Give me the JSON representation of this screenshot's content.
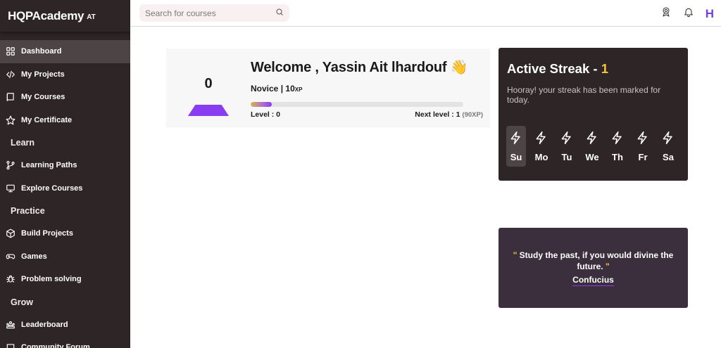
{
  "brand": {
    "name": "HQPAcademy",
    "suffix": "AT"
  },
  "sidebar": {
    "items": [
      {
        "label": "Dashboard",
        "icon": "grid-icon",
        "active": true
      },
      {
        "label": "My Projects",
        "icon": "code-icon"
      },
      {
        "label": "My Courses",
        "icon": "book-icon"
      },
      {
        "label": "My Certificate",
        "icon": "star-icon"
      },
      {
        "section": "Learn"
      },
      {
        "label": "Learning Paths",
        "icon": "path-icon"
      },
      {
        "label": "Explore Courses",
        "icon": "monitor-icon"
      },
      {
        "section": "Practice"
      },
      {
        "label": "Build Projects",
        "icon": "cube-icon"
      },
      {
        "label": "Games",
        "icon": "gamepad-icon"
      },
      {
        "label": "Problem solving",
        "icon": "bug-icon"
      },
      {
        "section": "Grow"
      },
      {
        "label": "Leaderboard",
        "icon": "users-icon"
      },
      {
        "label": "Community Forum",
        "icon": "forum-icon"
      }
    ]
  },
  "header": {
    "search_placeholder": "Search for courses",
    "avatar_letter": "H",
    "icons": [
      "award-icon",
      "bell-icon"
    ]
  },
  "welcome": {
    "level_number": "0",
    "title": "Welcome , Yassin Ait lhardouf 👋",
    "rank": "Novice",
    "xp_value": "10",
    "xp_unit": "XP",
    "progress_fraction": 0.1,
    "level_label": "Level : 0",
    "next_level_label": "Next level : 1",
    "next_level_xp": "(90XP)"
  },
  "streak": {
    "title": "Active Streak - ",
    "count": "1",
    "message": "Hooray! your streak has been marked for today.",
    "days": [
      {
        "label": "Su",
        "active": true
      },
      {
        "label": "Mo"
      },
      {
        "label": "Tu"
      },
      {
        "label": "We"
      },
      {
        "label": "Th"
      },
      {
        "label": "Fr"
      },
      {
        "label": "Sa"
      }
    ]
  },
  "quote": {
    "open_mark": "\"",
    "text": " Study the past, if you would divine the future. ",
    "close_mark": "\"",
    "author": "Confucius"
  },
  "colors": {
    "sidebar_bg": "#2e2527",
    "accent_purple": "#8a3cf0",
    "streak_yellow": "#f5c33b",
    "quote_bg": "#3b2f3d"
  }
}
